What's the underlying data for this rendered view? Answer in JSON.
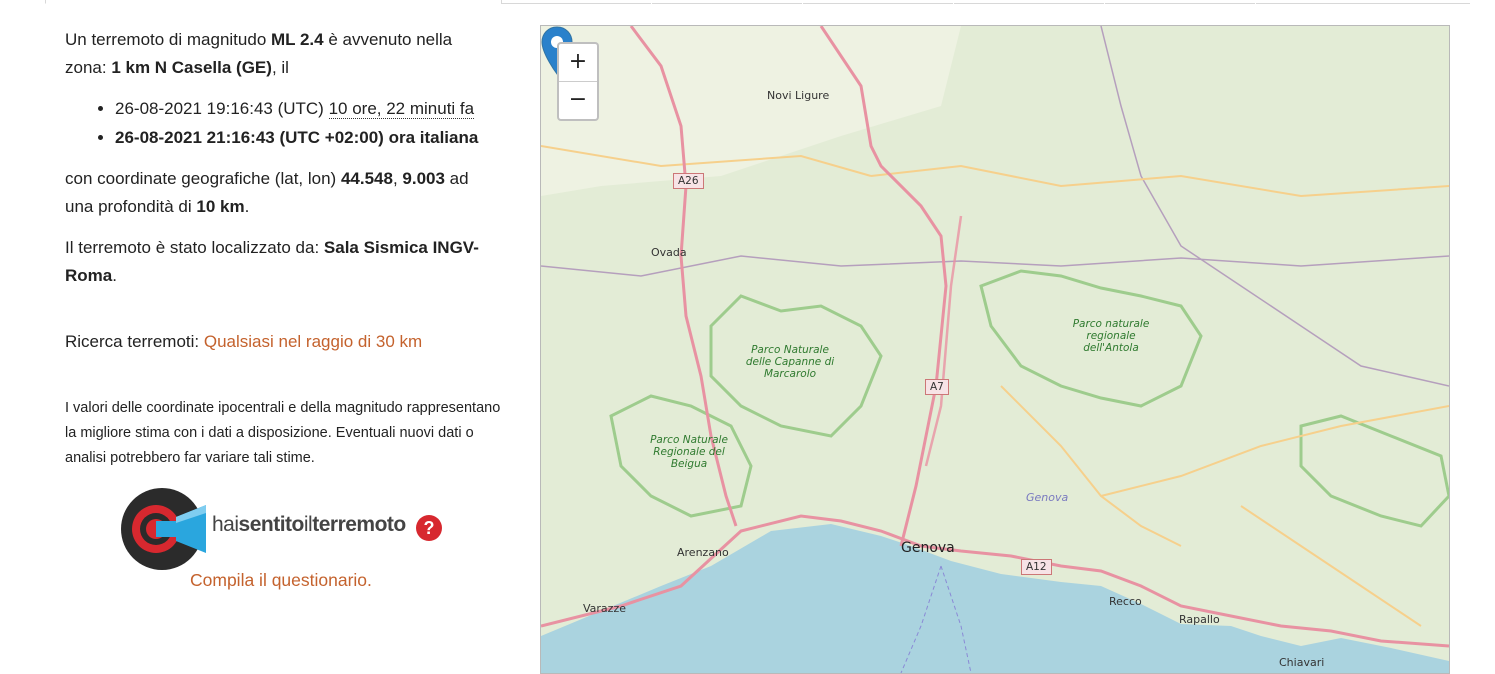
{
  "event": {
    "intro_prefix": "Un terremoto di magnitudo ",
    "magnitude": "ML 2.4",
    "intro_mid": " è avvenuto nella zona: ",
    "zone": "1 km N Casella (GE)",
    "intro_suffix": ", il",
    "utc_time": "26-08-2021 19:16:43 (UTC)",
    "relative_time": "10 ore, 22 minuti fa",
    "local_time": "26-08-2021 21:16:43 (UTC +02:00) ora italiana",
    "coords_prefix": "con coordinate geografiche (lat, lon) ",
    "lat": "44.548",
    "coords_sep": ", ",
    "lon": "9.003",
    "depth_prefix": " ad una profondità di ",
    "depth": "10 km",
    "depth_suffix": ".",
    "located_prefix": "Il terremoto è stato localizzato da: ",
    "located_by": "Sala Sismica INGV-Roma",
    "located_suffix": "."
  },
  "search": {
    "label": "Ricerca terremoti: ",
    "link": "Qualsiasi nel raggio di 30 km"
  },
  "note": "I valori delle coordinate ipocentrali e della magnitudo rappresentano la migliore stima con i dati a disposizione. Eventuali nuovi dati o analisi potrebbero far variare tali stime.",
  "hst": {
    "logo_prefix": "hai",
    "logo_bold": "sentito",
    "logo_mid": "il",
    "logo_bold2": "terremoto",
    "question": "?",
    "link": "Compila il questionario."
  },
  "map": {
    "zoom_in": "+",
    "zoom_out": "−",
    "labels": {
      "novi": "Novi Ligure",
      "ovada": "Ovada",
      "arenzano": "Arenzano",
      "varazze": "Varazze",
      "genova": "Genova",
      "genova_river": "Genova",
      "recco": "Recco",
      "rapallo": "Rapallo",
      "chiavari": "Chiavari"
    },
    "parks": {
      "capanne": "Parco Naturale delle Capanne di Marcarolo",
      "beigua": "Parco Naturale Regionale del Beigua",
      "antola": "Parco naturale regionale dell'Antola"
    },
    "roads": {
      "a26": "A26",
      "a7": "A7",
      "a12": "A12"
    },
    "colors": {
      "sea": "#aad3df",
      "land": "#e3ecd6",
      "park_border": "#8cc47a",
      "motorway": "#e892a2",
      "marker": "#2a81cb"
    }
  }
}
